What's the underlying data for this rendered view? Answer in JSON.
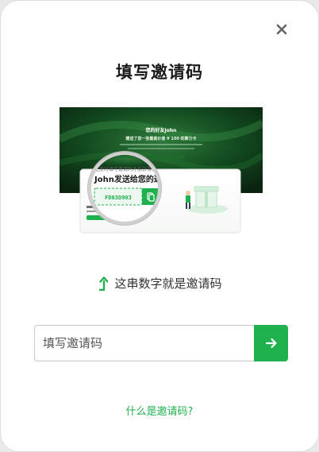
{
  "dialog": {
    "title": "填写邀请码",
    "close_icon": "close-icon",
    "accent_color": "#1fb14e"
  },
  "illustration": {
    "banner_line1": "您的好友John",
    "banner_line2": "赠送了您一张最高价值 ¥ 100 的算力卡",
    "card_note": "注册时填写邀请码才能获得奖",
    "card_title": "John发送给您的邀",
    "sample_code": "FD03D903",
    "copy_icon": "copy-icon"
  },
  "hint": {
    "icon": "arrow-up-icon",
    "text": "这串数字就是邀请码"
  },
  "form": {
    "placeholder": "填写邀请码",
    "value": "",
    "submit_icon": "arrow-right-icon"
  },
  "help_link": {
    "label": "什么是邀请码?"
  }
}
